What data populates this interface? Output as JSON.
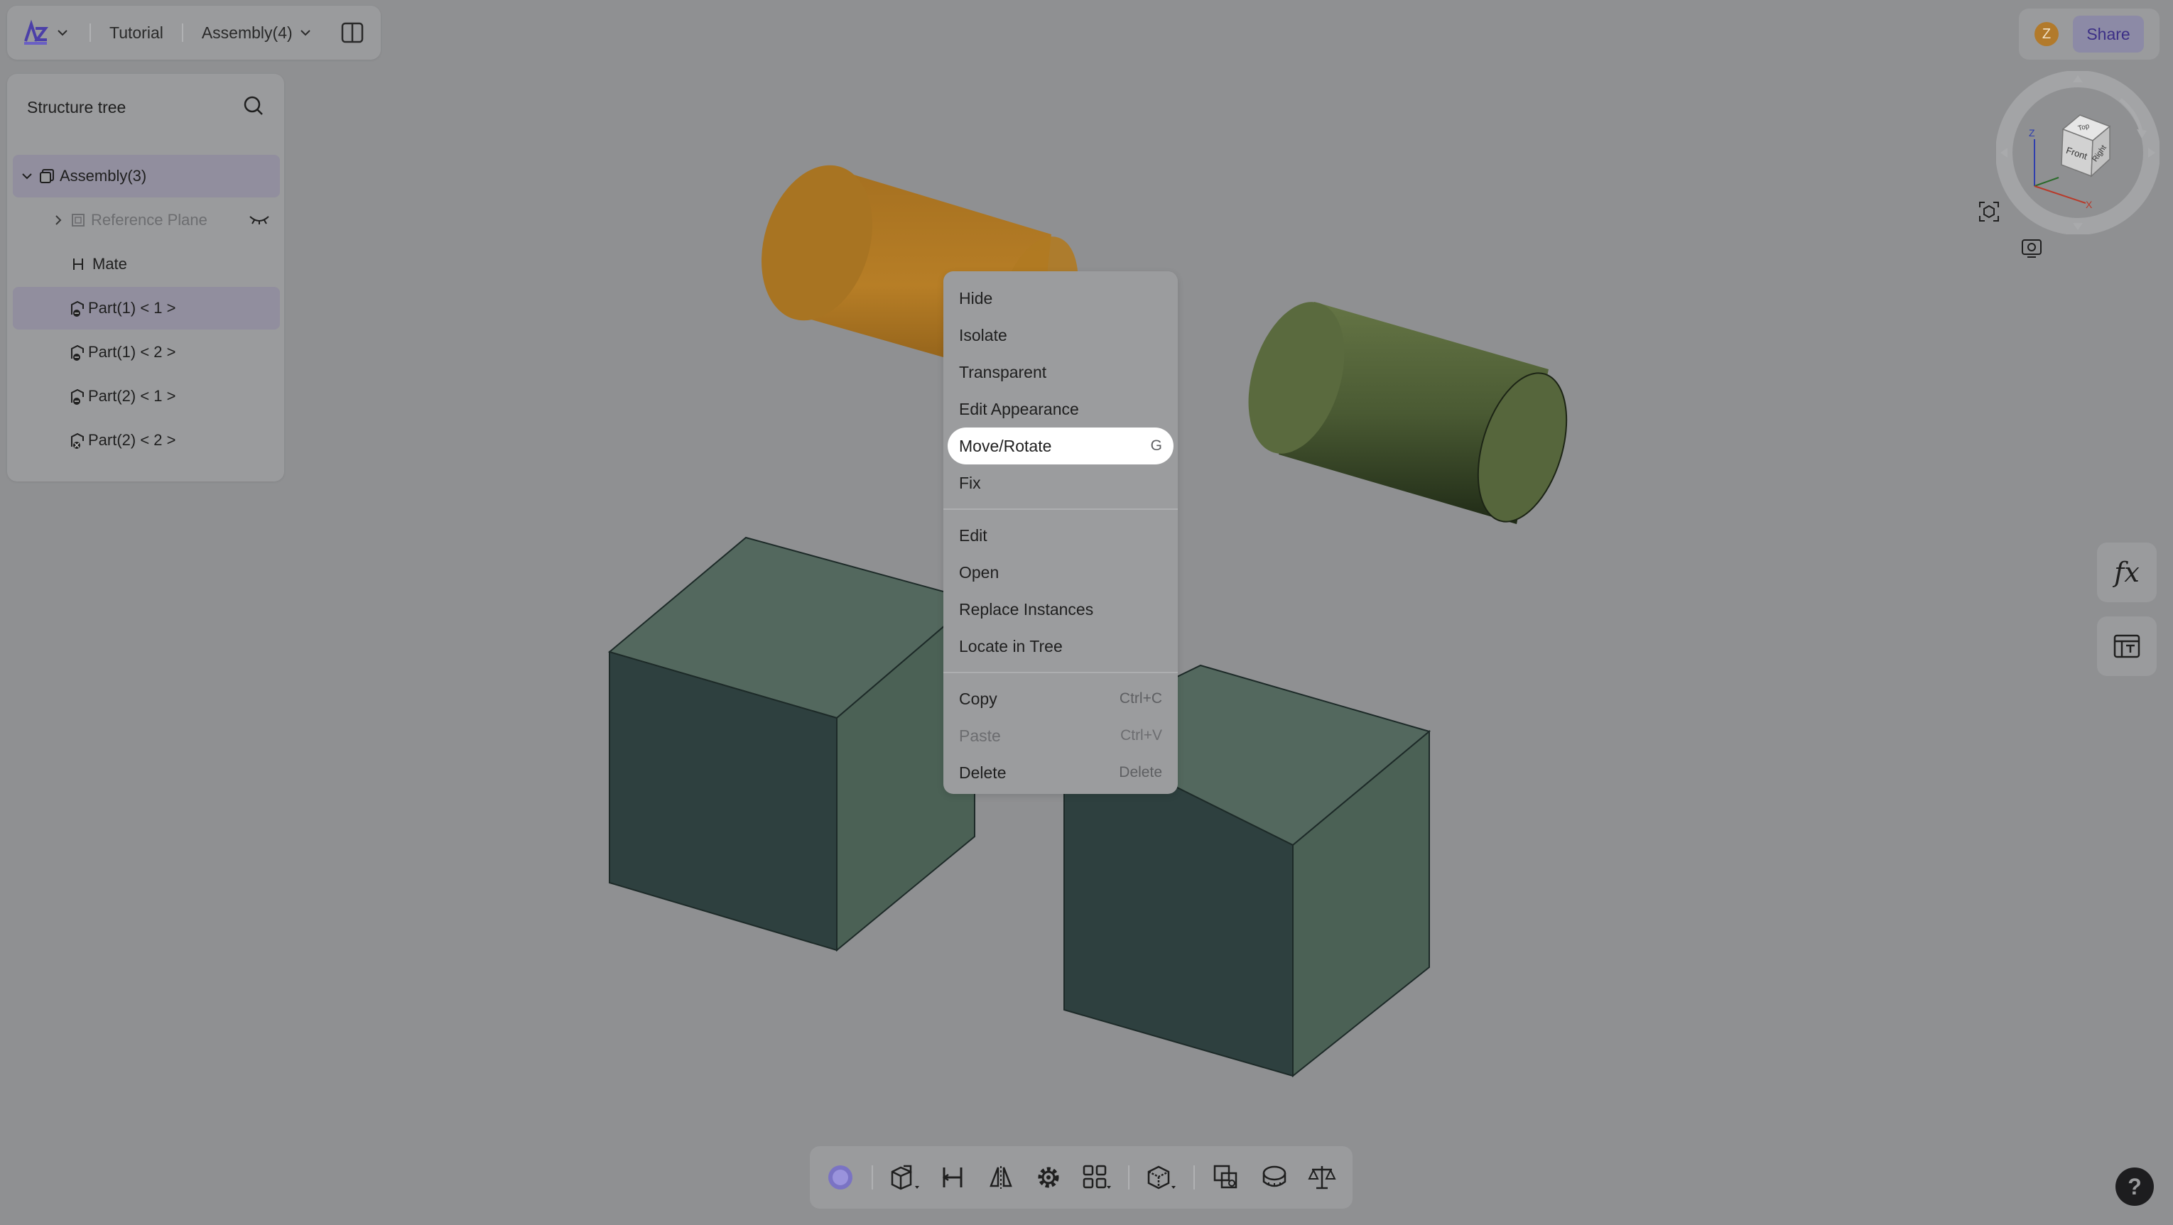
{
  "topbar": {
    "breadcrumbs": [
      "Tutorial",
      "Assembly(4)"
    ]
  },
  "tree": {
    "title": "Structure tree",
    "items": [
      {
        "label": "Assembly(3)"
      },
      {
        "label": "Reference Plane"
      },
      {
        "label": "Mate"
      },
      {
        "label": "Part(1) < 1 >"
      },
      {
        "label": "Part(1) < 2 >"
      },
      {
        "label": "Part(2) < 1 >"
      },
      {
        "label": "Part(2) < 2 >"
      }
    ]
  },
  "user": {
    "initial": "Z"
  },
  "share_label": "Share",
  "viewcube": {
    "faces": [
      "Top",
      "Front",
      "Right"
    ],
    "axes": [
      "Z",
      "X"
    ]
  },
  "formula_label": "fx",
  "context_menu": {
    "items": [
      {
        "label": "Hide",
        "shortcut": ""
      },
      {
        "label": "Isolate",
        "shortcut": ""
      },
      {
        "label": "Transparent",
        "shortcut": ""
      },
      {
        "label": "Edit Appearance",
        "shortcut": ""
      },
      {
        "label": "Move/Rotate",
        "shortcut": "G"
      },
      {
        "label": "Fix",
        "shortcut": ""
      },
      {
        "label": "Edit",
        "shortcut": ""
      },
      {
        "label": "Open",
        "shortcut": ""
      },
      {
        "label": "Replace Instances",
        "shortcut": ""
      },
      {
        "label": "Locate in Tree",
        "shortcut": ""
      },
      {
        "label": "Copy",
        "shortcut": "Ctrl+C"
      },
      {
        "label": "Paste",
        "shortcut": "Ctrl+V"
      },
      {
        "label": "Delete",
        "shortcut": "Delete"
      }
    ]
  },
  "help_label": "?",
  "colors": {
    "cylinder_orange": "#b07a22",
    "cylinder_green": "#56663c",
    "box_top": "#53685e",
    "box_front": "#2e403f",
    "box_side": "#4b6155",
    "accent": "#3c2f86"
  }
}
